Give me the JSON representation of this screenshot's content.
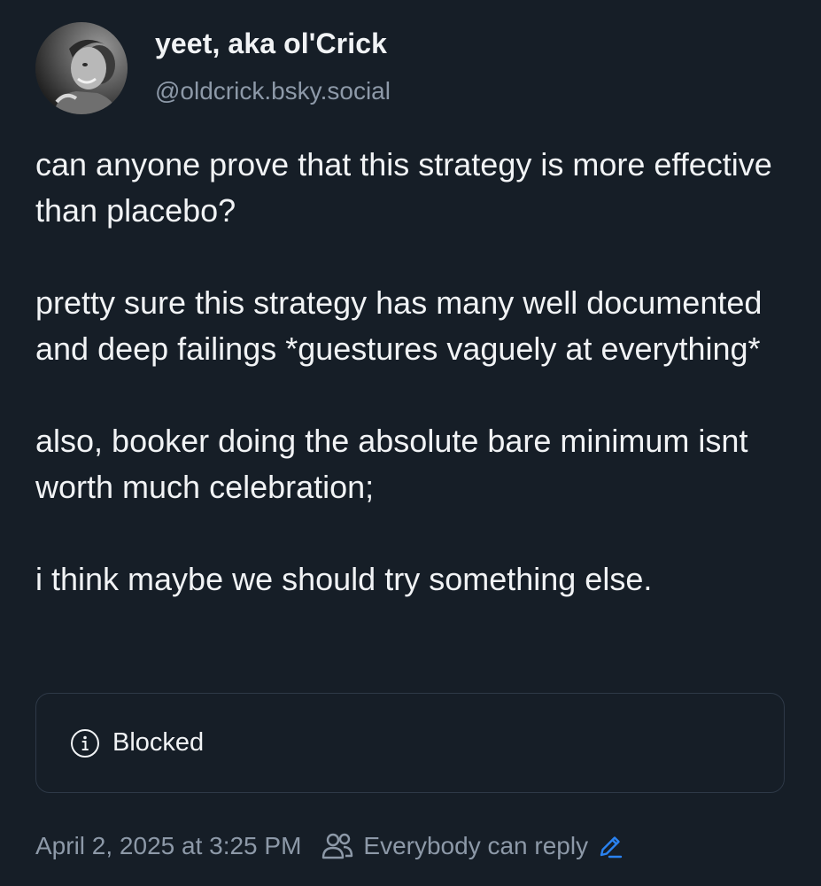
{
  "author": {
    "display_name": "yeet, aka ol'Crick",
    "handle": "@oldcrick.bsky.social",
    "avatar_icon": "avatar-photo"
  },
  "post": {
    "paragraphs": [
      "can anyone prove that this strategy is more effective than placebo?",
      "pretty sure this strategy has many well documented and deep failings *guestures vaguely at everything*",
      "also, booker doing the absolute bare minimum isnt worth much celebration;",
      "i think maybe we should try something else."
    ]
  },
  "embed": {
    "icon": "info-icon",
    "label": "Blocked"
  },
  "footer": {
    "timestamp": "April 2, 2025 at 3:25 PM",
    "reply_icon": "people-icon",
    "reply_setting": "Everybody can reply",
    "edit_icon": "pencil-icon"
  },
  "colors": {
    "background": "#161e27",
    "text": "#f1f3f5",
    "muted": "#8d99a8",
    "accent": "#2a82f0",
    "border": "#2e3947"
  }
}
